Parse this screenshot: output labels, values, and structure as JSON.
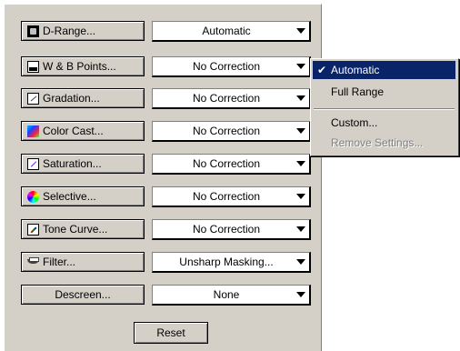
{
  "rows": [
    {
      "button": "D-Range...",
      "value": "Automatic",
      "icon": "d-range-icon"
    },
    {
      "button": "W & B Points...",
      "value": "No Correction",
      "icon": "wb-points-icon"
    },
    {
      "button": "Gradation...",
      "value": "No Correction",
      "icon": "gradation-icon"
    },
    {
      "button": "Color Cast...",
      "value": "No Correction",
      "icon": "color-cast-icon"
    },
    {
      "button": "Saturation...",
      "value": "No Correction",
      "icon": "saturation-icon"
    },
    {
      "button": "Selective...",
      "value": "No Correction",
      "icon": "selective-icon"
    },
    {
      "button": "Tone Curve...",
      "value": "No Correction",
      "icon": "tone-curve-icon"
    },
    {
      "button": "Filter...",
      "value": "Unsharp Masking...",
      "icon": "filter-icon"
    },
    {
      "button": "Descreen...",
      "value": "None",
      "icon": ""
    }
  ],
  "reset_label": "Reset",
  "menu": {
    "items": [
      {
        "label": "Automatic",
        "checked": true,
        "highlighted": true,
        "disabled": false
      },
      {
        "label": "Full Range",
        "checked": false,
        "highlighted": false,
        "disabled": false
      },
      {
        "label": "Custom...",
        "checked": false,
        "highlighted": false,
        "disabled": false
      },
      {
        "label": "Remove Settings...",
        "checked": false,
        "highlighted": false,
        "disabled": true
      }
    ],
    "check_glyph": "✔"
  },
  "colors": {
    "panel": "#d4d0c8",
    "highlight": "#0a246a",
    "disabled_text": "#808080"
  }
}
